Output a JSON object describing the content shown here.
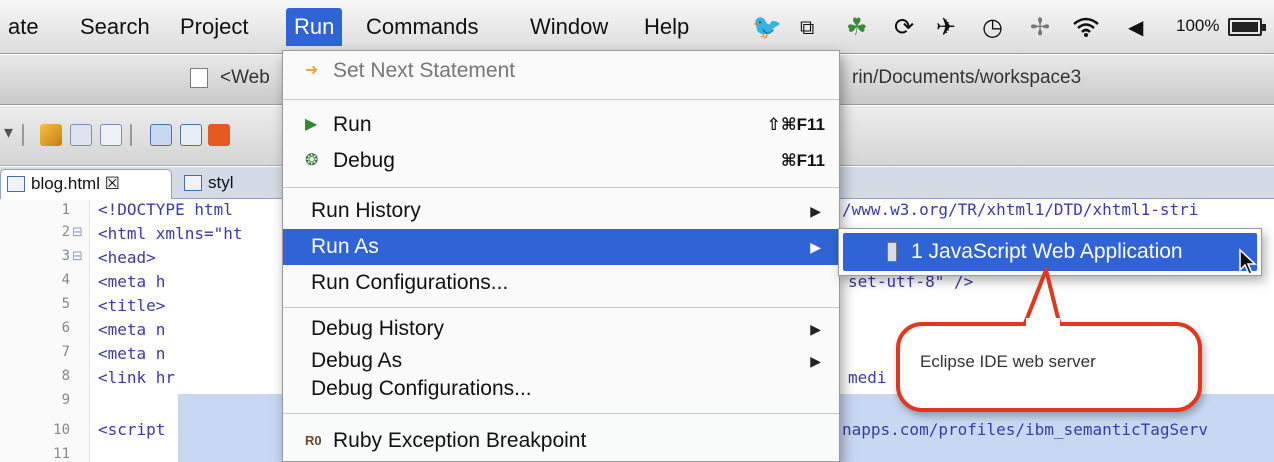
{
  "menubar": {
    "items": [
      "ate",
      "Search",
      "Project",
      "Run",
      "Commands",
      "Window",
      "Help"
    ],
    "active_item": "Run",
    "battery_text": "100%",
    "battery_level": 1.0,
    "tray_icons": [
      "bird-icon",
      "window-icon",
      "app-icon",
      "sync-icon",
      "airplane-icon",
      "clock-icon",
      "bluetooth-icon",
      "wifi-icon",
      "volume-icon"
    ]
  },
  "window": {
    "title_left": "<Web",
    "title_right": "rin/Documents/workspace3"
  },
  "tabs": [
    {
      "label": "blog.html ☒",
      "selected": true
    },
    {
      "label": "styl",
      "selected": false
    }
  ],
  "editor": {
    "line_numbers": [
      "1",
      "2",
      "3",
      "4",
      "5",
      "6",
      "7",
      "8",
      "9",
      "10",
      "11"
    ],
    "code_lines": [
      "<!DOCTYPE html",
      "<html xmlns=\"ht",
      "    <head>",
      "        <meta h",
      "        <title>",
      "        <meta n",
      "        <meta n",
      "        <link hr",
      "",
      "        <script",
      ""
    ],
    "right_fragments": [
      "/www.w3.org/TR/xhtml1/DTD/xhtml1-stri",
      "set-utf-8\" />",
      "medi",
      "napps.com/profiles/ibm_semanticTagServ"
    ]
  },
  "run_menu": {
    "set_next_statement": "Set Next Statement",
    "run": {
      "label": "Run",
      "shortcut": "⇧⌘F11"
    },
    "debug": {
      "label": "Debug",
      "shortcut": "⌘F11"
    },
    "run_history": "Run History",
    "run_as": "Run As",
    "run_configurations": "Run Configurations...",
    "debug_history": "Debug History",
    "debug_as": "Debug As",
    "debug_configurations": "Debug Configurations...",
    "ruby_exception_breakpoint": "Ruby Exception Breakpoint",
    "ruby_icon_text": "R0"
  },
  "submenu": {
    "item": "1 JavaScript Web Application"
  },
  "callout": {
    "text": "Eclipse IDE web server"
  }
}
